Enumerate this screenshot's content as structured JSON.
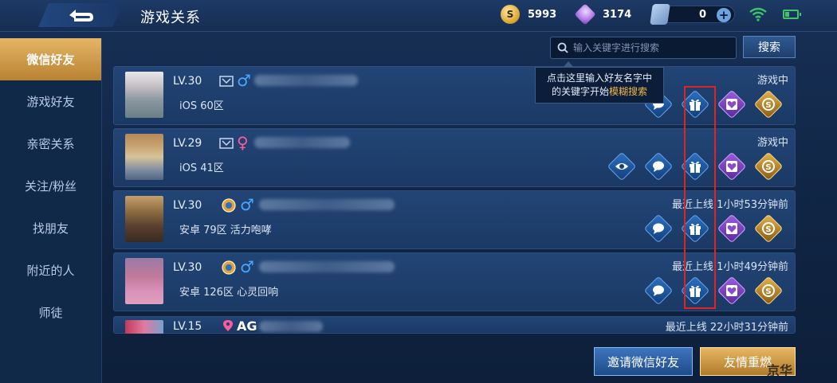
{
  "header": {
    "title": "游戏关系",
    "gold": "5993",
    "diamonds": "3174",
    "tickets": "0",
    "gold_icon": "S",
    "plus": "+"
  },
  "sidebar": {
    "items": [
      {
        "label": "微信好友",
        "active": true
      },
      {
        "label": "游戏好友"
      },
      {
        "label": "亲密关系"
      },
      {
        "label": "关注/粉丝"
      },
      {
        "label": "找朋友"
      },
      {
        "label": "附近的人"
      },
      {
        "label": "师徒"
      }
    ]
  },
  "search": {
    "placeholder": "输入关键字进行搜索",
    "button": "搜索"
  },
  "tooltip": {
    "line1": "点击这里输入好友名字中",
    "line2_prefix": "的关键字开始",
    "line2_highlight": "模糊搜索"
  },
  "friends": [
    {
      "level": "LV.30",
      "gender": "♂",
      "name_visible": "",
      "server": "iOS 60区",
      "status": "游戏中"
    },
    {
      "level": "LV.29",
      "gender": "♀",
      "name_visible": "",
      "server": "iOS 41区",
      "status": "游戏中"
    },
    {
      "level": "LV.30",
      "gender": "♂",
      "name_visible": "",
      "server": "安卓 79区 活力咆哮",
      "status": "最近上线  1小时53分钟前"
    },
    {
      "level": "LV.30",
      "gender": "♂",
      "name_visible": "",
      "server": "安卓 126区 心灵回响",
      "status": "最近上线  1小时49分钟前"
    },
    {
      "level": "LV.15",
      "gender": "",
      "name_visible": "AG",
      "server": "",
      "status": "最近上线   22小时31分钟前"
    }
  ],
  "icons": {
    "eye": "eye-icon",
    "chat": "chat-bubble-icon",
    "gift": "gift-icon",
    "heart": "heart-card-icon",
    "coin": "gold-coin-icon"
  },
  "bottom": {
    "invite": "邀请微信好友",
    "rekindle": "友情重燃"
  },
  "watermark": "京华",
  "colors": {
    "accent_gold": "#e5b567",
    "highlight_red": "#e02424",
    "male": "#49a8ff",
    "female": "#ff5b9c"
  }
}
